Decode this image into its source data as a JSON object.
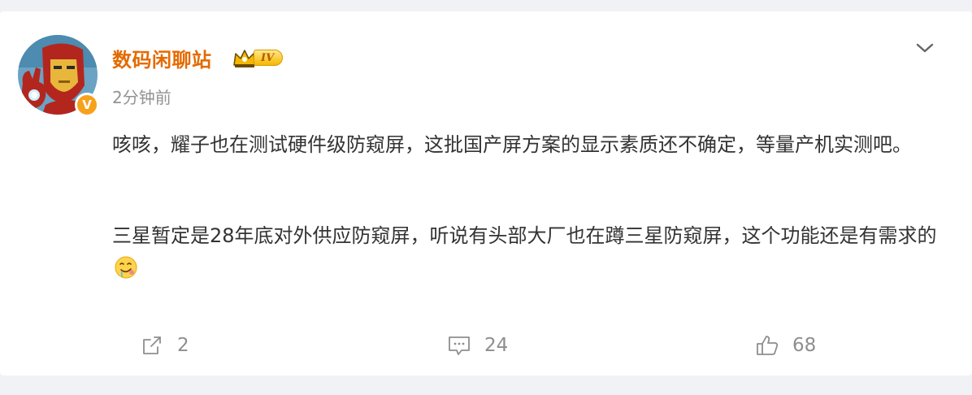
{
  "post": {
    "author": "数码闲聊站",
    "level_badge": "IV",
    "verified_mark": "V",
    "timestamp": "2分钟前",
    "paragraph1": "咳咳，耀子也在测试硬件级防窥屏，这批国产屏方案的显示素质还不确定，等量产机实测吧。",
    "paragraph2": "三星暂定是28年底对外供应防窥屏，听说有头部大厂也在蹲三星防窥屏，这个功能还是有需求的",
    "emoji": "drooling-face-emoji"
  },
  "actions": {
    "repost": {
      "icon": "share-icon",
      "count": "2"
    },
    "comment": {
      "icon": "comment-icon",
      "count": "24"
    },
    "like": {
      "icon": "thumbs-up-icon",
      "count": "68"
    }
  },
  "menu": {
    "icon": "chevron-down-icon"
  },
  "colors": {
    "username": "#e46a00",
    "verified_badge": "#f7a11b",
    "text": "#333333",
    "muted": "#8e8e8e",
    "background": "#f1f2f5"
  }
}
